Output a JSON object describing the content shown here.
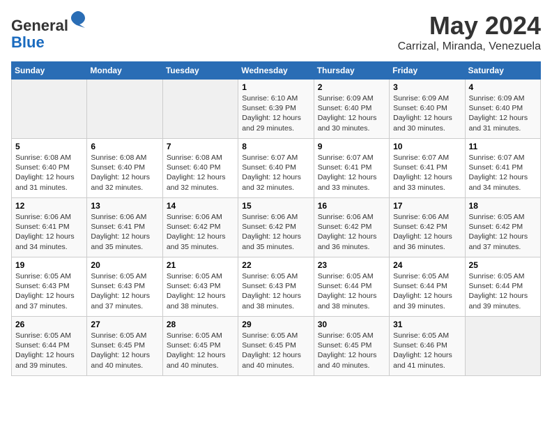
{
  "header": {
    "logo_line1": "General",
    "logo_line2": "Blue",
    "month_title": "May 2024",
    "location": "Carrizal, Miranda, Venezuela"
  },
  "weekdays": [
    "Sunday",
    "Monday",
    "Tuesday",
    "Wednesday",
    "Thursday",
    "Friday",
    "Saturday"
  ],
  "weeks": [
    [
      {
        "day": "",
        "info": ""
      },
      {
        "day": "",
        "info": ""
      },
      {
        "day": "",
        "info": ""
      },
      {
        "day": "1",
        "info": "Sunrise: 6:10 AM\nSunset: 6:39 PM\nDaylight: 12 hours\nand 29 minutes."
      },
      {
        "day": "2",
        "info": "Sunrise: 6:09 AM\nSunset: 6:40 PM\nDaylight: 12 hours\nand 30 minutes."
      },
      {
        "day": "3",
        "info": "Sunrise: 6:09 AM\nSunset: 6:40 PM\nDaylight: 12 hours\nand 30 minutes."
      },
      {
        "day": "4",
        "info": "Sunrise: 6:09 AM\nSunset: 6:40 PM\nDaylight: 12 hours\nand 31 minutes."
      }
    ],
    [
      {
        "day": "5",
        "info": "Sunrise: 6:08 AM\nSunset: 6:40 PM\nDaylight: 12 hours\nand 31 minutes."
      },
      {
        "day": "6",
        "info": "Sunrise: 6:08 AM\nSunset: 6:40 PM\nDaylight: 12 hours\nand 32 minutes."
      },
      {
        "day": "7",
        "info": "Sunrise: 6:08 AM\nSunset: 6:40 PM\nDaylight: 12 hours\nand 32 minutes."
      },
      {
        "day": "8",
        "info": "Sunrise: 6:07 AM\nSunset: 6:40 PM\nDaylight: 12 hours\nand 32 minutes."
      },
      {
        "day": "9",
        "info": "Sunrise: 6:07 AM\nSunset: 6:41 PM\nDaylight: 12 hours\nand 33 minutes."
      },
      {
        "day": "10",
        "info": "Sunrise: 6:07 AM\nSunset: 6:41 PM\nDaylight: 12 hours\nand 33 minutes."
      },
      {
        "day": "11",
        "info": "Sunrise: 6:07 AM\nSunset: 6:41 PM\nDaylight: 12 hours\nand 34 minutes."
      }
    ],
    [
      {
        "day": "12",
        "info": "Sunrise: 6:06 AM\nSunset: 6:41 PM\nDaylight: 12 hours\nand 34 minutes."
      },
      {
        "day": "13",
        "info": "Sunrise: 6:06 AM\nSunset: 6:41 PM\nDaylight: 12 hours\nand 35 minutes."
      },
      {
        "day": "14",
        "info": "Sunrise: 6:06 AM\nSunset: 6:42 PM\nDaylight: 12 hours\nand 35 minutes."
      },
      {
        "day": "15",
        "info": "Sunrise: 6:06 AM\nSunset: 6:42 PM\nDaylight: 12 hours\nand 35 minutes."
      },
      {
        "day": "16",
        "info": "Sunrise: 6:06 AM\nSunset: 6:42 PM\nDaylight: 12 hours\nand 36 minutes."
      },
      {
        "day": "17",
        "info": "Sunrise: 6:06 AM\nSunset: 6:42 PM\nDaylight: 12 hours\nand 36 minutes."
      },
      {
        "day": "18",
        "info": "Sunrise: 6:05 AM\nSunset: 6:42 PM\nDaylight: 12 hours\nand 37 minutes."
      }
    ],
    [
      {
        "day": "19",
        "info": "Sunrise: 6:05 AM\nSunset: 6:43 PM\nDaylight: 12 hours\nand 37 minutes."
      },
      {
        "day": "20",
        "info": "Sunrise: 6:05 AM\nSunset: 6:43 PM\nDaylight: 12 hours\nand 37 minutes."
      },
      {
        "day": "21",
        "info": "Sunrise: 6:05 AM\nSunset: 6:43 PM\nDaylight: 12 hours\nand 38 minutes."
      },
      {
        "day": "22",
        "info": "Sunrise: 6:05 AM\nSunset: 6:43 PM\nDaylight: 12 hours\nand 38 minutes."
      },
      {
        "day": "23",
        "info": "Sunrise: 6:05 AM\nSunset: 6:44 PM\nDaylight: 12 hours\nand 38 minutes."
      },
      {
        "day": "24",
        "info": "Sunrise: 6:05 AM\nSunset: 6:44 PM\nDaylight: 12 hours\nand 39 minutes."
      },
      {
        "day": "25",
        "info": "Sunrise: 6:05 AM\nSunset: 6:44 PM\nDaylight: 12 hours\nand 39 minutes."
      }
    ],
    [
      {
        "day": "26",
        "info": "Sunrise: 6:05 AM\nSunset: 6:44 PM\nDaylight: 12 hours\nand 39 minutes."
      },
      {
        "day": "27",
        "info": "Sunrise: 6:05 AM\nSunset: 6:45 PM\nDaylight: 12 hours\nand 40 minutes."
      },
      {
        "day": "28",
        "info": "Sunrise: 6:05 AM\nSunset: 6:45 PM\nDaylight: 12 hours\nand 40 minutes."
      },
      {
        "day": "29",
        "info": "Sunrise: 6:05 AM\nSunset: 6:45 PM\nDaylight: 12 hours\nand 40 minutes."
      },
      {
        "day": "30",
        "info": "Sunrise: 6:05 AM\nSunset: 6:45 PM\nDaylight: 12 hours\nand 40 minutes."
      },
      {
        "day": "31",
        "info": "Sunrise: 6:05 AM\nSunset: 6:46 PM\nDaylight: 12 hours\nand 41 minutes."
      },
      {
        "day": "",
        "info": ""
      }
    ]
  ]
}
